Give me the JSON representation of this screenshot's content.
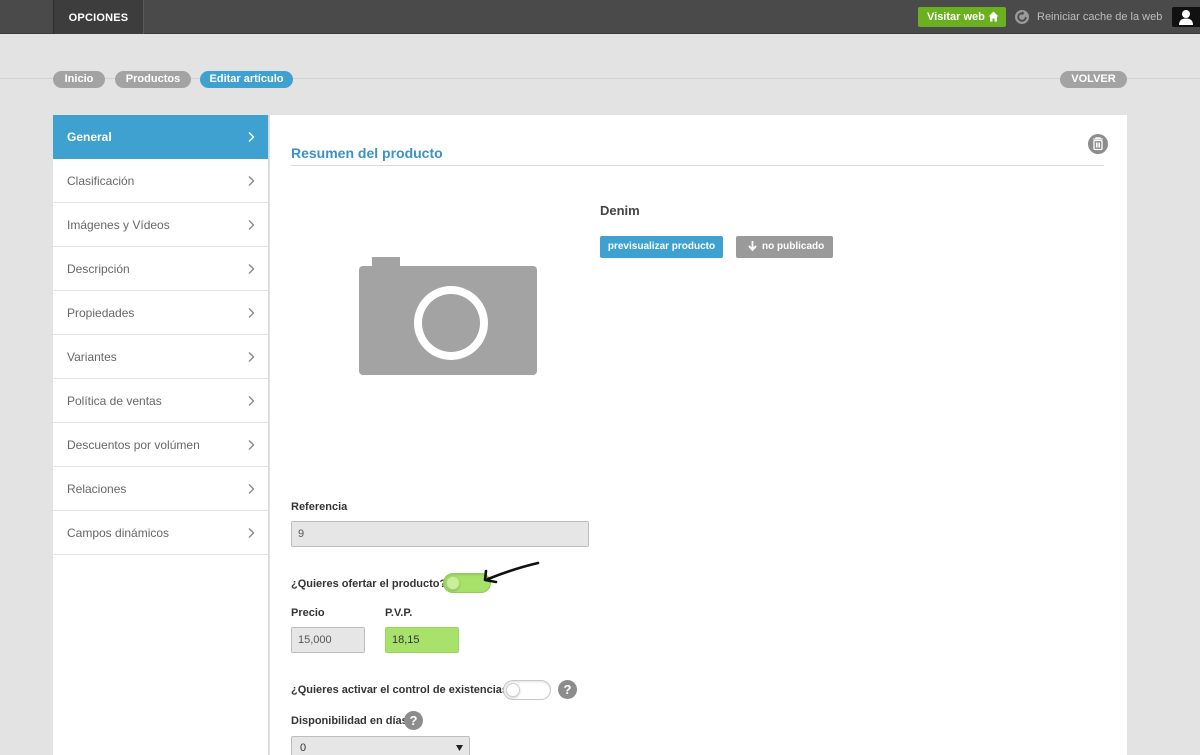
{
  "topbar": {
    "opciones": "OPCIONES",
    "visitar_web": "Visitar web",
    "reiniciar": "Reiniciar cache de la web"
  },
  "breadcrumb": {
    "items": [
      "Inicio",
      "Productos",
      "Editar artículo"
    ],
    "volver": "VOLVER"
  },
  "sidebar": {
    "items": [
      {
        "label": "General",
        "active": true
      },
      {
        "label": "Clasificación"
      },
      {
        "label": "Imágenes y Vídeos"
      },
      {
        "label": "Descripción"
      },
      {
        "label": "Propiedades"
      },
      {
        "label": "Variantes"
      },
      {
        "label": "Política de ventas"
      },
      {
        "label": "Descuentos por volúmen"
      },
      {
        "label": "Relaciones"
      },
      {
        "label": "Campos dinámicos"
      }
    ]
  },
  "main": {
    "title": "Resumen del producto",
    "product_name": "Denim",
    "preview_button": "previsualizar producto",
    "publish_button": "no publicado",
    "referencia_label": "Referencia",
    "referencia_value": "9",
    "ofertar_label": "¿Quieres ofertar el producto?",
    "ofertar_on": true,
    "precio_label": "Precio",
    "precio_value": "15,000",
    "pvp_label": "P.V.P.",
    "pvp_value": "18,15",
    "existencias_label": "¿Quieres activar el control de existencias?",
    "existencias_on": false,
    "disponibilidad_label": "Disponibilidad en días",
    "disponibilidad_value": "0"
  },
  "colors": {
    "accent": "#3ea1d0",
    "green": "#6bb020",
    "highlight_green": "#a8e26b",
    "topbar": "#4a4a4a"
  }
}
